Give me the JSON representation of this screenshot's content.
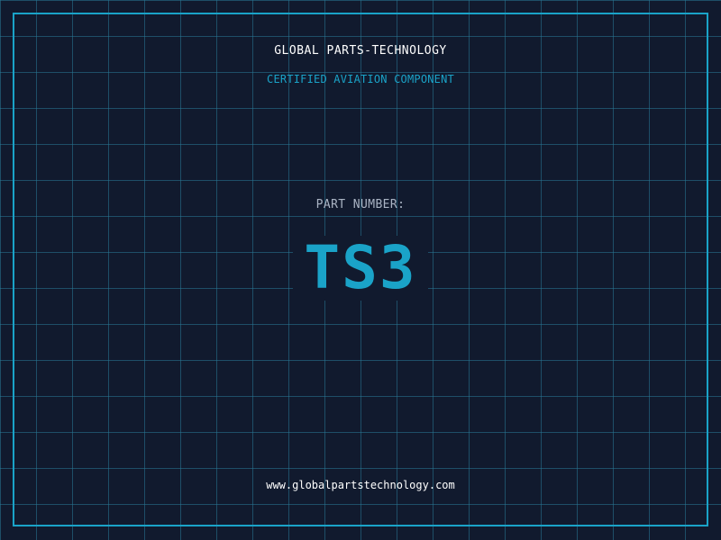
{
  "header": {
    "company_name": "GLOBAL PARTS-TECHNOLOGY",
    "tagline": "CERTIFIED AVIATION COMPONENT"
  },
  "part": {
    "label": "PART NUMBER:",
    "number": "TS3"
  },
  "footer": {
    "website": "www.globalpartstechnology.com"
  },
  "colors": {
    "background": "#111a2e",
    "accent": "#1aa3c8",
    "grid": "#287896",
    "text_primary": "#ffffff",
    "text_muted": "#aab4c4"
  }
}
